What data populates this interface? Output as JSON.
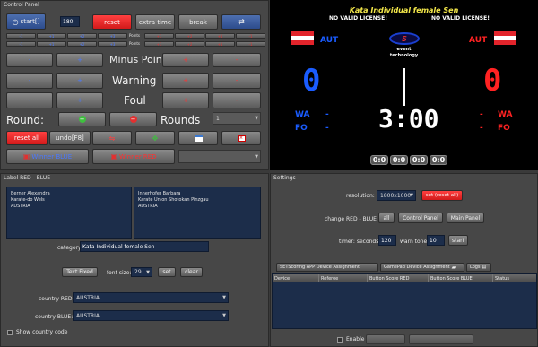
{
  "control_panel": {
    "title": "Control Panel",
    "start_label": "start[]",
    "time_value": "180",
    "reset_label": "reset",
    "extra_time_label": "extra time",
    "break_label": "break",
    "points_label_1": "Points",
    "points_label_2": "Points",
    "minus_point_label": "Minus Point",
    "warning_label": "Warning",
    "foul_label": "Foul",
    "round_label": "Round:",
    "rounds_label": "Rounds",
    "rounds_value": "1",
    "reset_all_label": "reset all",
    "undo_label": "undo[F8]",
    "winner_blue_label": "Winner BLUE",
    "winner_red_label": "Winner RED"
  },
  "scoreboard": {
    "title": "Kata Individual female Sen",
    "license_left": "NO VALID LICENSE!",
    "license_right": "NO VALID LICENSE!",
    "country_left": "AUT",
    "country_right": "AUT",
    "logo_line1": "event",
    "logo_line2": "technology",
    "score_blue": "0",
    "score_red": "0",
    "wa_left": "WA",
    "fo_left": "FO",
    "wa_right": "WA",
    "fo_right": "FO",
    "dash": "-",
    "timer": "3:00",
    "boxes": [
      "0:0",
      "0:0",
      "0:0",
      "0:0"
    ],
    "colors": {
      "blue": "#1a5cff",
      "red": "#ff2222"
    }
  },
  "labels_panel": {
    "title": "Label RED - BLUE",
    "blue_name": "Berner Alexandra",
    "blue_club": "Karate-do Wels",
    "blue_country": "AUSTRIA",
    "red_name": "Innerhofer Barbara",
    "red_club": "Karate Union Shotokan Pinzgau",
    "red_country": "AUSTRIA",
    "category_label": "category:",
    "category_value": "Kata Individual female Sen",
    "text_fixed_value": "Text Fixed",
    "font_size_label": "font size:",
    "font_size_value": "29",
    "set_label": "set",
    "clear_label": "clear",
    "country_red_label": "country RED:",
    "country_red_value": "AUSTRIA",
    "country_blue_label": "country BLUE:",
    "country_blue_value": "AUSTRIA",
    "show_country_code_label": "Show country code"
  },
  "settings": {
    "title": "Settings",
    "resolution_label": "resolution:",
    "resolution_value": "1800x1000",
    "set_reset_all_label": "set (reset all)",
    "change_label": "change  RED - BLUE",
    "all_label": "all",
    "control_panel_btn": "Control Panel",
    "main_panel_btn": "Main Panel",
    "timer_label": "timer: seconds",
    "timer_seconds": "120",
    "warn_tone_label": "warn tone",
    "warn_tone_value": "10",
    "start_label": "start",
    "tabs": [
      "SETScoring APP Device Assignment",
      "GamePad Device Assignment",
      "Logs"
    ],
    "table_headers": [
      "Device",
      "Referee",
      "Button Score RED",
      "Button Score BLUE",
      "Status"
    ],
    "enable_label": "Enable"
  }
}
